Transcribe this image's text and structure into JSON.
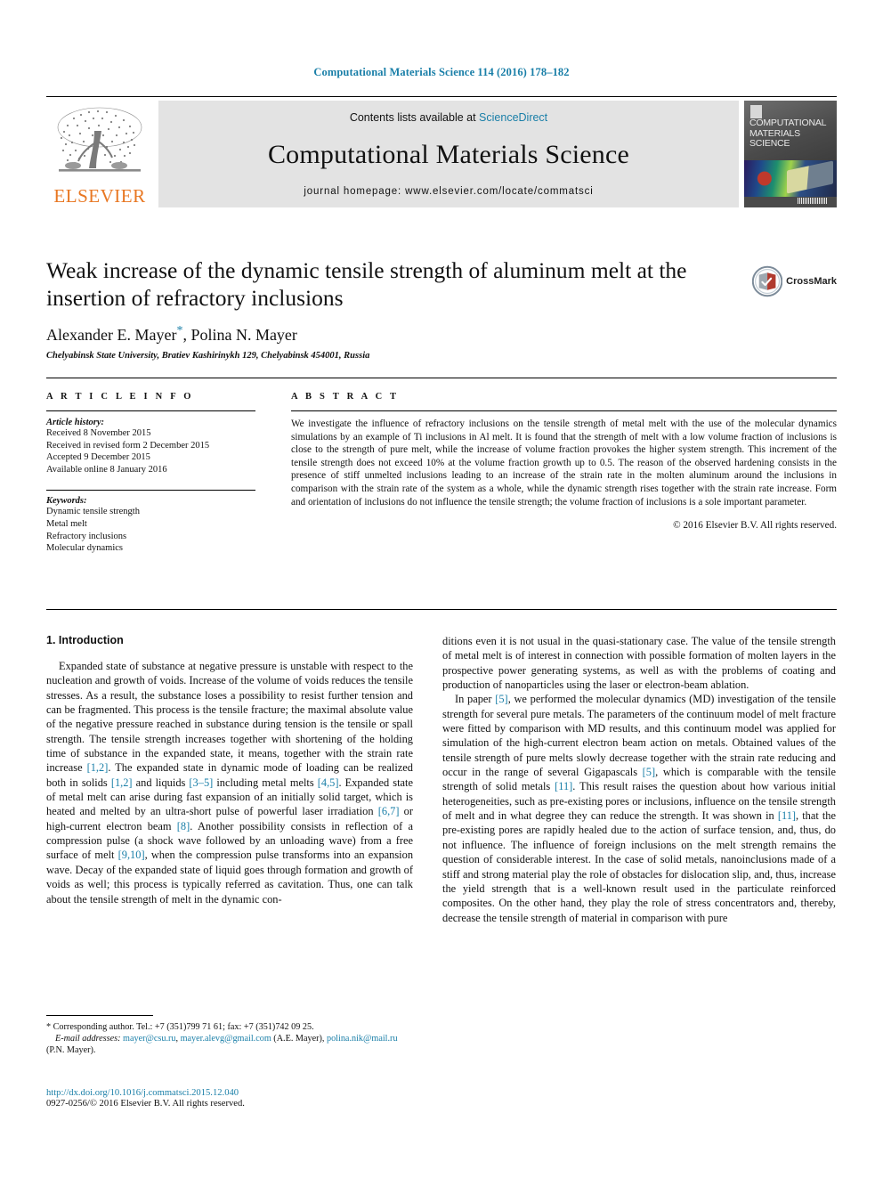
{
  "running_head": "Computational Materials Science 114 (2016) 178–182",
  "masthead": {
    "publisher": "ELSEVIER",
    "contents_prefix": "Contents lists available at ",
    "contents_link": "ScienceDirect",
    "journal_title": "Computational Materials Science",
    "homepage": "journal homepage: www.elsevier.com/locate/commatsci",
    "cover_title_lines": [
      "COMPUTATIONAL",
      "MATERIALS",
      "SCIENCE"
    ]
  },
  "crossmark": {
    "label": "CrossMark"
  },
  "article": {
    "title": "Weak increase of the dynamic tensile strength of aluminum melt at the insertion of refractory inclusions",
    "authors": "Alexander E. Mayer",
    "authors_rest": ", Polina N. Mayer",
    "corresponding_marker": "*",
    "affiliation": "Chelyabinsk State University, Bratiev Kashirinykh 129, Chelyabinsk 454001, Russia"
  },
  "info": {
    "heading": "A R T I C L E    I N F O",
    "history_title": "Article history:",
    "history": [
      "Received 8 November 2015",
      "Received in revised form 2 December 2015",
      "Accepted 9 December 2015",
      "Available online 8 January 2016"
    ],
    "keywords_title": "Keywords:",
    "keywords": [
      "Dynamic tensile strength",
      "Metal melt",
      "Refractory inclusions",
      "Molecular dynamics"
    ]
  },
  "abstract": {
    "heading": "A B S T R A C T",
    "text": "We investigate the influence of refractory inclusions on the tensile strength of metal melt with the use of the molecular dynamics simulations by an example of Ti inclusions in Al melt. It is found that the strength of melt with a low volume fraction of inclusions is close to the strength of pure melt, while the increase of volume fraction provokes the higher system strength. This increment of the tensile strength does not exceed 10% at the volume fraction growth up to 0.5. The reason of the observed hardening consists in the presence of stiff unmelted inclusions leading to an increase of the strain rate in the molten aluminum around the inclusions in comparison with the strain rate of the system as a whole, while the dynamic strength rises together with the strain rate increase. Form and orientation of inclusions do not influence the tensile strength; the volume fraction of inclusions is a sole important parameter.",
    "copyright": "© 2016 Elsevier B.V. All rights reserved."
  },
  "body": {
    "section_heading": "1. Introduction",
    "left_p1_a": "Expanded state of substance at negative pressure is unstable with respect to the nucleation and growth of voids. Increase of the volume of voids reduces the tensile stresses. As a result, the substance loses a possibility to resist further tension and can be fragmented. This process is the tensile fracture; the maximal absolute value of the negative pressure reached in substance during tension is the tensile or spall strength. The tensile strength increases together with shortening of the holding time of substance in the expanded state, it means, together with the strain rate increase ",
    "ref1": "[1,2]",
    "left_p1_b": ". The expanded state in dynamic mode of loading can be realized both in solids ",
    "ref2": "[1,2]",
    "left_p1_c": " and liquids ",
    "ref3": "[3–5]",
    "left_p1_d": " including metal melts ",
    "ref4": "[4,5]",
    "left_p1_e": ". Expanded state of metal melt can arise during fast expansion of an initially solid target, which is heated and melted by an ultra-short pulse of powerful laser irradiation ",
    "ref5": "[6,7]",
    "left_p1_f": " or high-current electron beam ",
    "ref6": "[8]",
    "left_p1_g": ". Another possibility consists in reflection of a compression pulse (a shock wave followed by an unloading wave) from a free surface of melt ",
    "ref7": "[9,10]",
    "left_p1_h": ", when the compression pulse transforms into an expansion wave. Decay of the expanded state of liquid goes through formation and growth of voids as well; this process is typically referred as cavitation. Thus, one can talk about the tensile strength of melt in the dynamic con-",
    "right_p1": "ditions even it is not usual in the quasi-stationary case. The value of the tensile strength of metal melt is of interest in connection with possible formation of molten layers in the prospective power generating systems, as well as with the problems of coating and production of nanoparticles using the laser or electron-beam ablation.",
    "right_p2_a": "In paper ",
    "rref1": "[5]",
    "right_p2_b": ", we performed the molecular dynamics (MD) investigation of the tensile strength for several pure metals. The parameters of the continuum model of melt fracture were fitted by comparison with MD results, and this continuum model was applied for simulation of the high-current electron beam action on metals. Obtained values of the tensile strength of pure melts slowly decrease together with the strain rate reducing and occur in the range of several Gigapascals ",
    "rref2": "[5]",
    "right_p2_c": ", which is comparable with the tensile strength of solid metals ",
    "rref3": "[11]",
    "right_p2_d": ". This result raises the question about how various initial heterogeneities, such as pre-existing pores or inclusions, influence on the tensile strength of melt and in what degree they can reduce the strength. It was shown in ",
    "rref4": "[11]",
    "right_p2_e": ", that the pre-existing pores are rapidly healed due to the action of surface tension, and, thus, do not influence. The influence of foreign inclusions on the melt strength remains the question of considerable interest. In the case of solid metals, nanoinclusions made of a stiff and strong material play the role of obstacles for dislocation slip, and, thus, increase the yield strength that is a well-known result used in the particulate reinforced composites. On the other hand, they play the role of stress concentrators and, thereby, decrease the tensile strength of material in comparison with pure"
  },
  "footnotes": {
    "corresponding_marker": "*",
    "corresponding": " Corresponding author. Tel.: +7 (351)799 71 61; fax: +7 (351)742 09 25.",
    "email_label": "E-mail addresses:",
    "email1": "mayer@csu.ru",
    "email_sep": ", ",
    "email2": "mayer.alevg@gmail.com",
    "email_owner1": " (A.E. Mayer), ",
    "email3": "polina.nik@mail.ru",
    "email_owner2": " (P.N. Mayer).",
    "doi": "http://dx.doi.org/10.1016/j.commatsci.2015.12.040",
    "issn": "0927-0256/© 2016 Elsevier B.V. All rights reserved."
  }
}
